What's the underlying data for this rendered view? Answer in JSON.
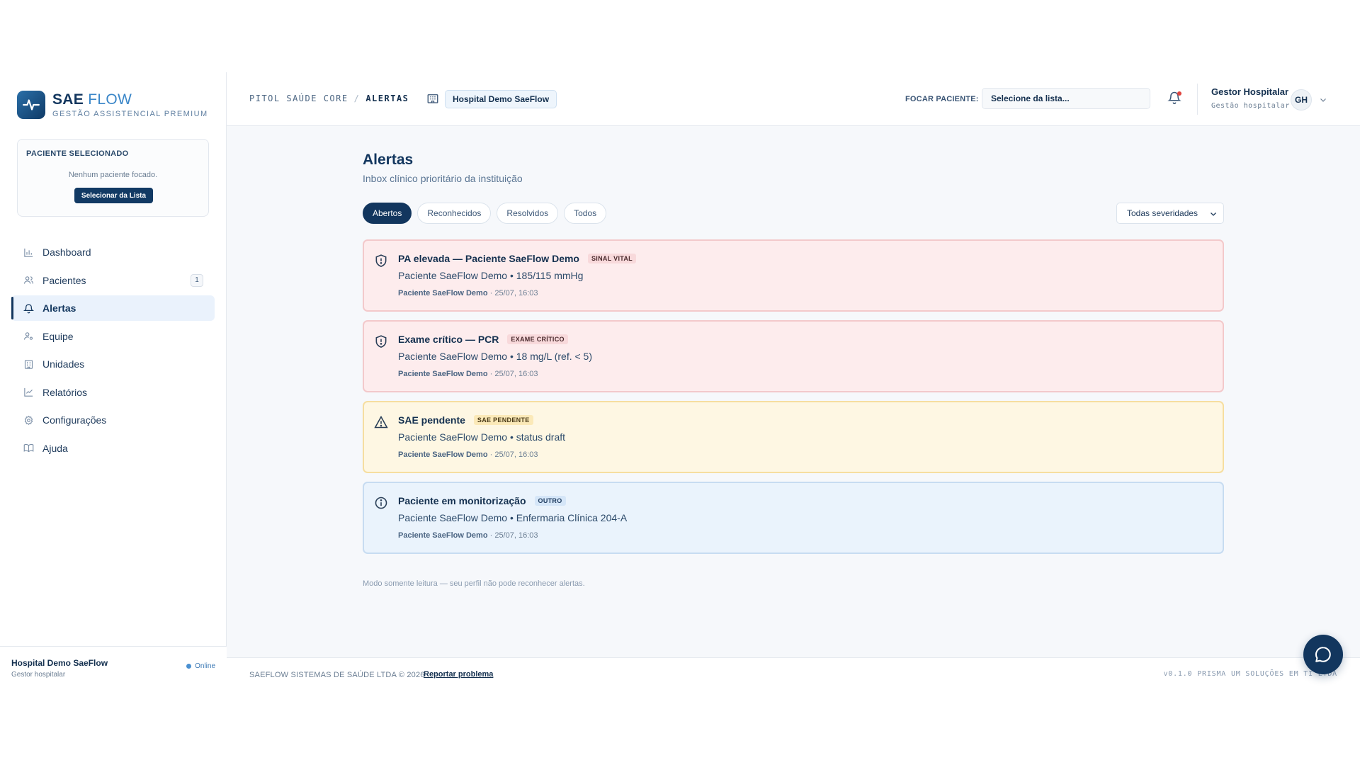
{
  "brand": {
    "title_a": "SAE",
    "title_b": "FLOW",
    "subtitle": "GESTÃO ASSISTENCIAL PREMIUM"
  },
  "patient_card": {
    "title": "PACIENTE SELECIONADO",
    "empty": "Nenhum paciente focado.",
    "button": "Selecionar da Lista"
  },
  "nav": [
    {
      "label": "Dashboard",
      "icon": "bar-chart-icon"
    },
    {
      "label": "Pacientes",
      "icon": "users-icon",
      "badge": "1"
    },
    {
      "label": "Alertas",
      "icon": "bell-icon",
      "active": true
    },
    {
      "label": "Equipe",
      "icon": "user-gear-icon"
    },
    {
      "label": "Unidades",
      "icon": "building-icon"
    },
    {
      "label": "Relatórios",
      "icon": "line-chart-icon"
    },
    {
      "label": "Configurações",
      "icon": "gear-icon"
    },
    {
      "label": "Ajuda",
      "icon": "book-icon"
    }
  ],
  "side_footer": {
    "name": "Hospital Demo SaeFlow",
    "role": "Gestor hospitalar",
    "status": "Online"
  },
  "header": {
    "crumb_root": "PITOL SAÚDE CORE",
    "crumb_sep": "/",
    "crumb_current": "ALERTAS",
    "hospital_chip": "Hospital Demo SaeFlow",
    "focus_label": "FOCAR PACIENTE:",
    "focus_placeholder": "Selecione da lista...",
    "user_name": "Gestor Hospitalar",
    "user_role": "Gestão hospitalar",
    "avatar": "GH"
  },
  "page": {
    "title": "Alertas",
    "subtitle": "Inbox clínico prioritário da instituição"
  },
  "tabs": [
    {
      "label": "Abertos",
      "active": true
    },
    {
      "label": "Reconhecidos"
    },
    {
      "label": "Resolvidos"
    },
    {
      "label": "Todos"
    }
  ],
  "severity_select": "Todas severidades",
  "alerts": [
    {
      "tone": "red",
      "icon": "shield-alert-icon",
      "title": "PA elevada — Paciente SaeFlow Demo",
      "tag": "SINAL VITAL",
      "desc": "Paciente SaeFlow Demo • 185/115 mmHg",
      "meta_patient": "Paciente SaeFlow Demo",
      "meta_time": " · 25/07, 16:03"
    },
    {
      "tone": "red",
      "icon": "shield-alert-icon",
      "title": "Exame crítico — PCR",
      "tag": "EXAME CRÍTICO",
      "desc": "Paciente SaeFlow Demo • 18 mg/L (ref. < 5)",
      "meta_patient": "Paciente SaeFlow Demo",
      "meta_time": " · 25/07, 16:03"
    },
    {
      "tone": "yellow",
      "icon": "warning-triangle-icon",
      "title": "SAE pendente",
      "tag": "SAE PENDENTE",
      "desc": "Paciente SaeFlow Demo • status draft",
      "meta_patient": "Paciente SaeFlow Demo",
      "meta_time": " · 25/07, 16:03"
    },
    {
      "tone": "blue",
      "icon": "info-circle-icon",
      "title": "Paciente em monitorização",
      "tag": "OUTRO",
      "desc": "Paciente SaeFlow Demo • Enfermaria Clínica 204-A",
      "meta_patient": "Paciente SaeFlow Demo",
      "meta_time": " · 25/07, 16:03"
    }
  ],
  "readonly_note": "Modo somente leitura — seu perfil não pode reconhecer alertas.",
  "footer": {
    "copy": "SAEFLOW SISTEMAS DE SAÚDE LTDA © 2026",
    "link": "Reportar problema",
    "version": "v0.1.0  PRISMA UM SOLUÇÕES EM TI LTDA"
  },
  "colors": {
    "primary": "#12365e",
    "accent": "#3a86c8",
    "alert_red_bg": "#fdeced",
    "alert_yellow_bg": "#fef7e3",
    "alert_blue_bg": "#eaf3fc",
    "notify_dot": "#e0453f"
  }
}
